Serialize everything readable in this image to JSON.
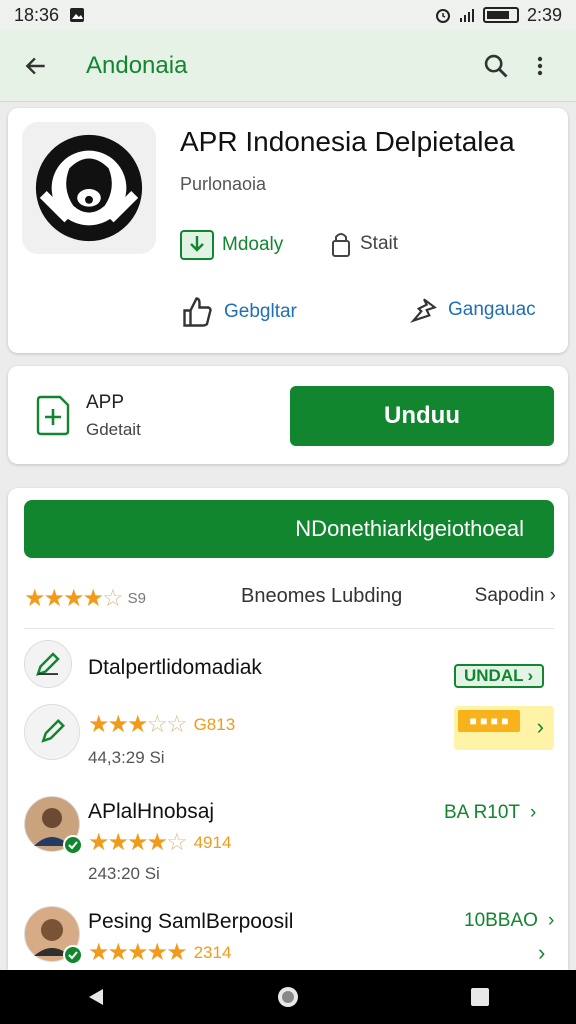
{
  "status": {
    "time_left": "18:36",
    "time_right": "2:39"
  },
  "appbar": {
    "title": "Andonaia"
  },
  "hero": {
    "title": "APR Indonesia Delpietalea",
    "subtitle": "Purlonaoia",
    "chip1": "Mdoaly",
    "chip2": "Stait",
    "chip3": "Gebgltar",
    "chip4": "Gangauac"
  },
  "install": {
    "label1": "APP",
    "label2": "Gdetait",
    "button": "Unduu"
  },
  "list": {
    "big_button": "NDonethiarklgeiothoeal",
    "rating_count": "S9",
    "rating_mid": "Bneomes Lubding",
    "rating_right": "Sapodin",
    "items": [
      {
        "title": "Dtalpertlidomadiak",
        "tag": "UNDAL"
      },
      {
        "rating": "G813",
        "sub": "44,3:29 Si"
      },
      {
        "title": "APlalHnobsaj",
        "rating": "4914",
        "sub": "243:20 Si",
        "right": "BA R10T"
      },
      {
        "title": "Pesing SamlBerpoosil",
        "rating": "2314",
        "right": "10BBAO"
      }
    ]
  },
  "colors": {
    "accent": "#12862f",
    "star": "#f29b1a"
  }
}
